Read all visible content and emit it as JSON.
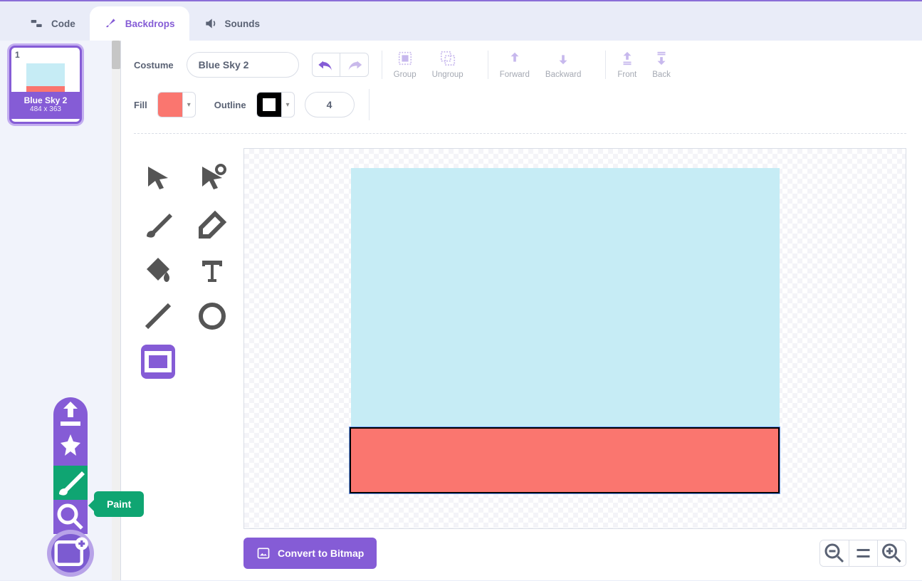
{
  "tabs": {
    "code": "Code",
    "backdrops": "Backdrops",
    "sounds": "Sounds"
  },
  "costume": {
    "index": "1",
    "name": "Blue Sky 2",
    "dims": "484 x 363",
    "label": "Costume"
  },
  "actions": {
    "group": "Group",
    "ungroup": "Ungroup",
    "forward": "Forward",
    "backward": "Backward",
    "front": "Front",
    "back": "Back"
  },
  "fill": {
    "label": "Fill",
    "color": "#fa766f"
  },
  "outline": {
    "label": "Outline",
    "color": "#000000",
    "width": "4"
  },
  "convert": "Convert to Bitmap",
  "tooltip": "Paint",
  "chart_data": null
}
